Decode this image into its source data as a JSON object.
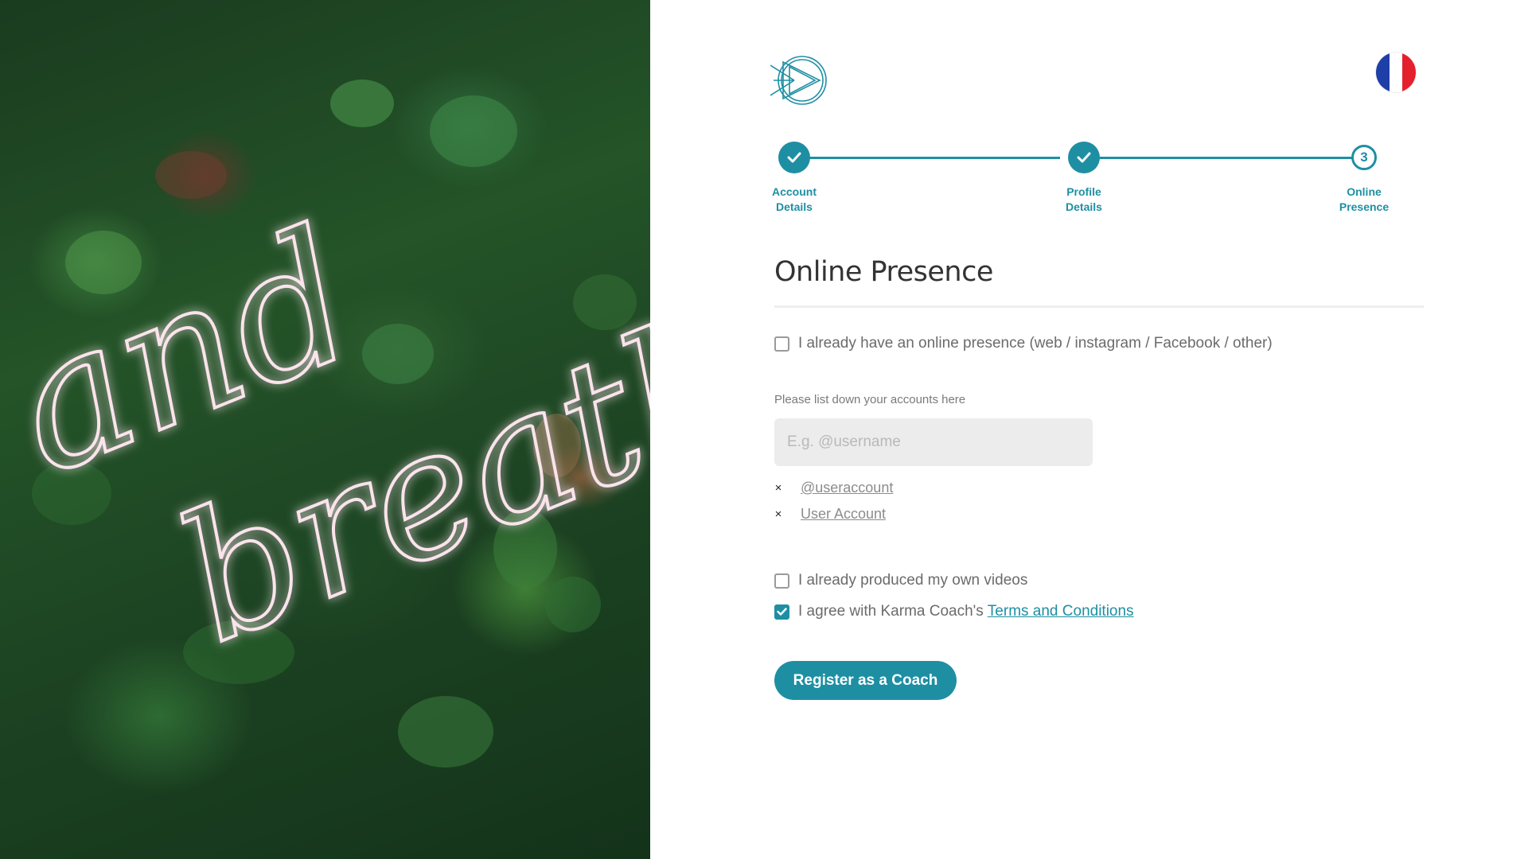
{
  "hero": {
    "neon_text_line1": "and",
    "neon_text_line2": "breathe"
  },
  "brand": {
    "logo_icon": "play-triangle-logo-icon"
  },
  "language": {
    "flag_icon": "france-flag-icon",
    "colors": [
      "#1f3fa8",
      "#ffffff",
      "#e4202c"
    ]
  },
  "stepper": {
    "steps": [
      {
        "label": "Account\nDetails",
        "state": "done"
      },
      {
        "label": "Profile\nDetails",
        "state": "done"
      },
      {
        "label": "Online\nPresence",
        "state": "current",
        "number": "3"
      }
    ]
  },
  "form": {
    "title": "Online Presence",
    "online_presence_checkbox": {
      "label": "I already have an online presence (web / instagram / Facebook / other)",
      "checked": false
    },
    "accounts_hint": "Please list down your accounts here",
    "accounts_input": {
      "placeholder": "E.g. @username",
      "value": ""
    },
    "accounts": [
      {
        "remove_icon": "×",
        "name": "@useraccount"
      },
      {
        "remove_icon": "×",
        "name": "User Account"
      }
    ],
    "videos_checkbox": {
      "label": "I already produced my own videos",
      "checked": false
    },
    "terms_checkbox": {
      "label": "I agree with Karma Coach's",
      "link": "Terms and Conditions",
      "checked": true
    },
    "submit_label": "Register as a Coach"
  },
  "colors": {
    "accent": "#1e8fa3",
    "text": "#6b6b6b",
    "input_bg": "#ececec"
  }
}
